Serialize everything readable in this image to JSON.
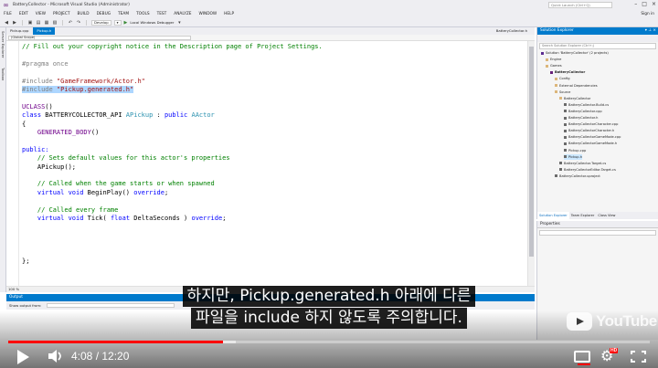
{
  "window": {
    "title": "BatteryCollector - Microsoft Visual Studio (Administrator)",
    "quick_launch_placeholder": "Quick Launch (Ctrl+Q)"
  },
  "menu": [
    "FILE",
    "EDIT",
    "VIEW",
    "PROJECT",
    "BUILD",
    "DEBUG",
    "TEAM",
    "TOOLS",
    "TEST",
    "ANALYZE",
    "WINDOW",
    "HELP"
  ],
  "sign_in": "Sign in",
  "toolbar": {
    "config": "Develop",
    "debugger": "Local Windows Debugger"
  },
  "left_strip": [
    "Server Explorer",
    "Toolbox"
  ],
  "editor": {
    "tabs": [
      {
        "label": "Pickup.cpp",
        "active": false
      },
      {
        "label": "Pickup.h",
        "active": true
      }
    ],
    "right_tab": "BatteryCollector.h",
    "scope": "(Global Scope)",
    "zoom": "100 %",
    "code_lines": [
      {
        "text": "// Fill out your copyright notice in the Description page of Project Settings.",
        "cls": "cmt"
      },
      {
        "text": "",
        "cls": ""
      },
      {
        "text": "#pragma once",
        "cls": "pre"
      },
      {
        "text": "",
        "cls": ""
      },
      {
        "text": "#include \"GameFramework/Actor.h\"",
        "cls": "inc"
      },
      {
        "text": "#include \"Pickup.generated.h\"",
        "cls": "inc-hl"
      },
      {
        "text": "",
        "cls": ""
      },
      {
        "text": "UCLASS()",
        "cls": "mac"
      },
      {
        "text": "class BATTERYCOLLECTOR_API APickup : public AActor",
        "cls": "cls"
      },
      {
        "text": "{",
        "cls": ""
      },
      {
        "text": "    GENERATED_BODY()",
        "cls": "mac"
      },
      {
        "text": "",
        "cls": ""
      },
      {
        "text": "public:",
        "cls": "kw"
      },
      {
        "text": "    // Sets default values for this actor's properties",
        "cls": "cmt"
      },
      {
        "text": "    APickup();",
        "cls": ""
      },
      {
        "text": "",
        "cls": ""
      },
      {
        "text": "    // Called when the game starts or when spawned",
        "cls": "cmt"
      },
      {
        "text": "    virtual void BeginPlay() override;",
        "cls": "virt"
      },
      {
        "text": "",
        "cls": ""
      },
      {
        "text": "    // Called every frame",
        "cls": "cmt"
      },
      {
        "text": "    virtual void Tick( float DeltaSeconds ) override;",
        "cls": "virt"
      },
      {
        "text": "",
        "cls": ""
      },
      {
        "text": "",
        "cls": ""
      },
      {
        "text": "",
        "cls": ""
      },
      {
        "text": "",
        "cls": ""
      },
      {
        "text": "};",
        "cls": ""
      }
    ]
  },
  "output": {
    "title": "Output",
    "show_from_label": "Show output from:"
  },
  "solution_explorer": {
    "title": "Solution Explorer",
    "search_placeholder": "Search Solution Explorer (Ctrl+;)",
    "items": [
      {
        "label": "Solution 'BatteryCollector' (2 projects)",
        "depth": 0,
        "icon": "solution-icon",
        "bold": false,
        "selected": false
      },
      {
        "label": "Engine",
        "depth": 1,
        "icon": "folder-icon",
        "bold": false,
        "selected": false
      },
      {
        "label": "Games",
        "depth": 1,
        "icon": "folder-icon",
        "bold": false,
        "selected": false
      },
      {
        "label": "BatteryCollector",
        "depth": 2,
        "icon": "project-icon",
        "bold": true,
        "selected": false
      },
      {
        "label": "Config",
        "depth": 3,
        "icon": "folder-icon",
        "bold": false,
        "selected": false
      },
      {
        "label": "External Dependencies",
        "depth": 3,
        "icon": "folder-icon",
        "bold": false,
        "selected": false
      },
      {
        "label": "Source",
        "depth": 3,
        "icon": "folder-icon",
        "bold": false,
        "selected": false
      },
      {
        "label": "BatteryCollector",
        "depth": 4,
        "icon": "folder-icon",
        "bold": false,
        "selected": false
      },
      {
        "label": "BatteryCollector.Build.cs",
        "depth": 5,
        "icon": "file-icon",
        "bold": false,
        "selected": false
      },
      {
        "label": "BatteryCollector.cpp",
        "depth": 5,
        "icon": "file-icon",
        "bold": false,
        "selected": false
      },
      {
        "label": "BatteryCollector.h",
        "depth": 5,
        "icon": "file-icon",
        "bold": false,
        "selected": false
      },
      {
        "label": "BatteryCollectorCharacter.cpp",
        "depth": 5,
        "icon": "file-icon",
        "bold": false,
        "selected": false
      },
      {
        "label": "BatteryCollectorCharacter.h",
        "depth": 5,
        "icon": "file-icon",
        "bold": false,
        "selected": false
      },
      {
        "label": "BatteryCollectorGameMode.cpp",
        "depth": 5,
        "icon": "file-icon",
        "bold": false,
        "selected": false
      },
      {
        "label": "BatteryCollectorGameMode.h",
        "depth": 5,
        "icon": "file-icon",
        "bold": false,
        "selected": false
      },
      {
        "label": "Pickup.cpp",
        "depth": 5,
        "icon": "file-icon",
        "bold": false,
        "selected": false
      },
      {
        "label": "Pickup.h",
        "depth": 5,
        "icon": "file-icon",
        "bold": false,
        "selected": true
      },
      {
        "label": "BatteryCollector.Target.cs",
        "depth": 4,
        "icon": "file-icon",
        "bold": false,
        "selected": false
      },
      {
        "label": "BatteryCollectorEditor.Target.cs",
        "depth": 4,
        "icon": "file-icon",
        "bold": false,
        "selected": false
      },
      {
        "label": "BatteryCollector.uproject",
        "depth": 3,
        "icon": "file-icon",
        "bold": false,
        "selected": false
      }
    ],
    "bottom_tabs": [
      {
        "label": "Solution Explorer",
        "active": true
      },
      {
        "label": "Team Explorer",
        "active": false
      },
      {
        "label": "Class View",
        "active": false
      }
    ]
  },
  "properties": {
    "title": "Properties"
  },
  "video": {
    "subtitle_lines": [
      "하지만, Pickup.generated.h 아래에 다른",
      "파일을 include 하지 않도록 주의합니다."
    ],
    "time_current": "4:08",
    "time_separator": " / ",
    "time_total": "12:20",
    "progress_played": 0.335,
    "progress_loaded": 0.355,
    "brand": "YouTube",
    "hd_badge": "HD"
  },
  "colors": {
    "vs_accent": "#007acc",
    "progress_red": "#ff0000"
  }
}
